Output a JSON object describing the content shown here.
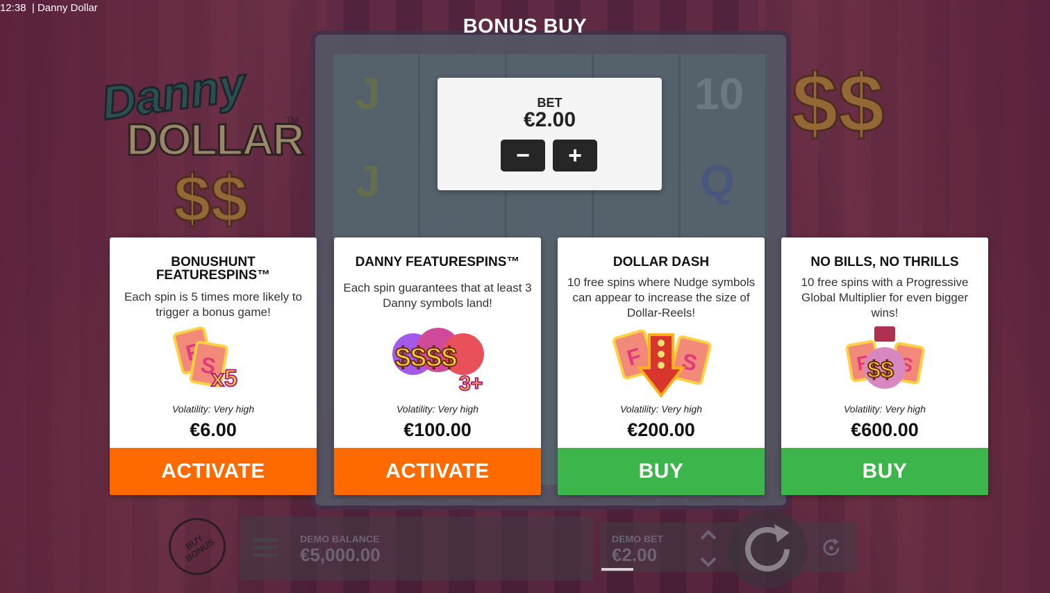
{
  "status": {
    "time": "12:38",
    "separator": "|",
    "game_name": "Danny Dollar"
  },
  "logo": {
    "line1": "Danny",
    "line2": "DOLLAR",
    "trademark": "TM"
  },
  "title": "BONUS BUY",
  "bet_panel": {
    "label": "BET",
    "value": "€2.00",
    "minus_label": "−",
    "plus_label": "+"
  },
  "cards": [
    {
      "title": "BONUSHUNT FEATURESPINS™",
      "description": "Each spin is 5 times more likely to trigger a bonus game!",
      "art_text": "x5",
      "volatility": "Volatility: Very high",
      "price": "€6.00",
      "button_label": "ACTIVATE",
      "button_color": "#ff6a00"
    },
    {
      "title": "DANNY FEATURESPINS™",
      "description": "Each spin guarantees that at least 3 Danny symbols land!",
      "art_text": "3+",
      "volatility": "Volatility: Very high",
      "price": "€100.00",
      "button_label": "ACTIVATE",
      "button_color": "#ff6a00"
    },
    {
      "title": "DOLLAR DASH",
      "description": "10 free spins where Nudge symbols can appear to increase the size of Dollar-Reels!",
      "art_text": "",
      "volatility": "Volatility: Very high",
      "price": "€200.00",
      "button_label": "BUY",
      "button_color": "#3cb54a"
    },
    {
      "title": "NO BILLS, NO THRILLS",
      "description": "10 free spins with a Progressive Global Multiplier for even bigger wins!",
      "art_text": "",
      "volatility": "Volatility: Very high",
      "price": "€600.00",
      "button_label": "BUY",
      "button_color": "#3cb54a"
    }
  ],
  "bottom_bar": {
    "buy_bonus_label": "BUY BONUS",
    "balance_label": "DEMO BALANCE",
    "balance_value": "€5,000.00",
    "bet_label": "DEMO BET",
    "bet_value": "€2.00"
  },
  "icons": {
    "menu": "hamburger-icon",
    "bet_arrows": "chevron-up-down-icon",
    "spin": "spin-arrow-icon",
    "autoplay": "autoplay-icon"
  }
}
